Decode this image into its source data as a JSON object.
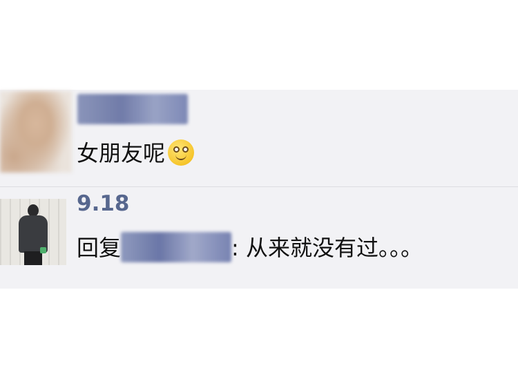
{
  "comments": [
    {
      "text": "女朋友呢",
      "emoji": "smiley-emoji"
    },
    {
      "username": "9.18",
      "reply_prefix": "回复",
      "reply_body": ": 从来就没有过。。。"
    }
  ],
  "colors": {
    "panel_bg": "#f2f2f5",
    "username": "#57678e",
    "text": "#111111",
    "divider": "#dddde2"
  }
}
